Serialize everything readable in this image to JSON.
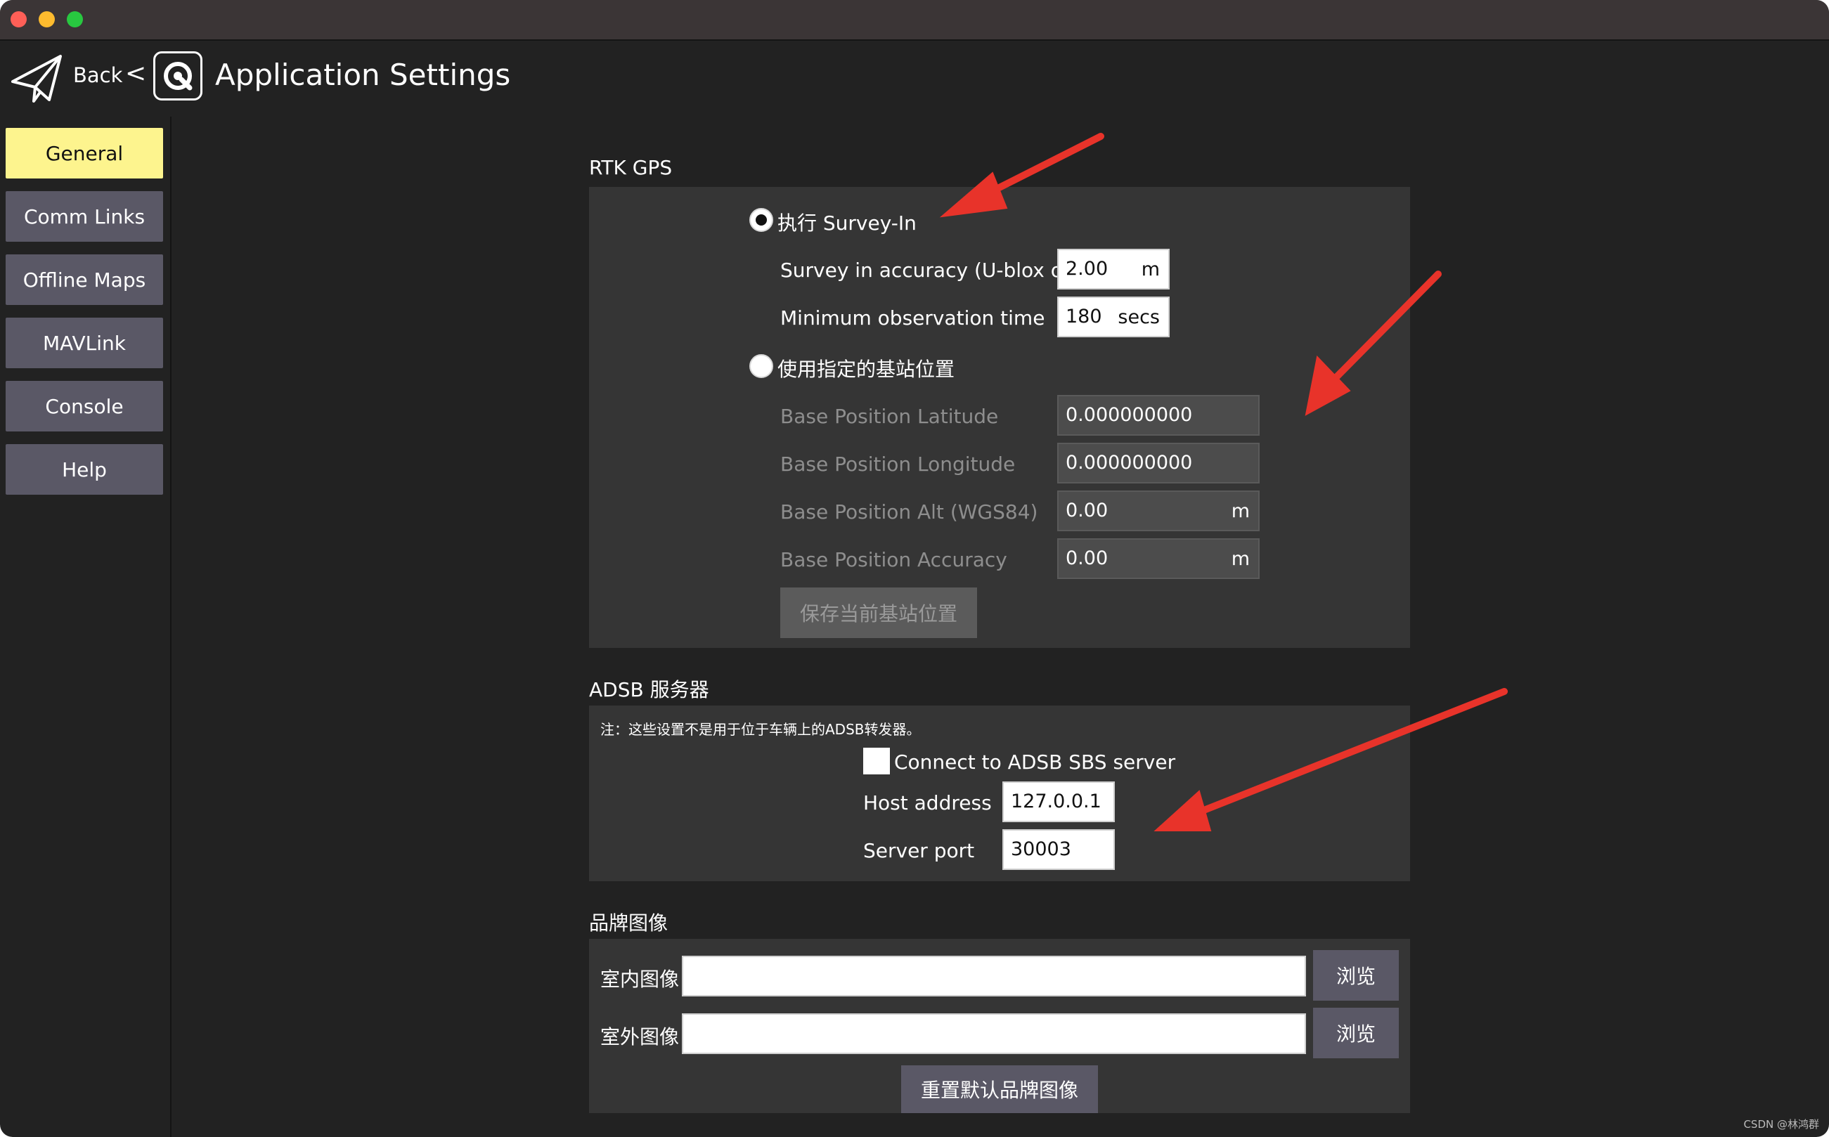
{
  "toolbar": {
    "back_label": "Back",
    "chevron": "<",
    "title": "Application Settings",
    "back_icon": "paper-plane-icon",
    "logo_icon": "app-logo-icon"
  },
  "sidebar": {
    "items": [
      {
        "label": "General",
        "active": true
      },
      {
        "label": "Comm Links",
        "active": false
      },
      {
        "label": "Offline Maps",
        "active": false
      },
      {
        "label": "MAVLink",
        "active": false
      },
      {
        "label": "Console",
        "active": false
      },
      {
        "label": "Help",
        "active": false
      }
    ]
  },
  "rtk": {
    "title": "RTK GPS",
    "survey_in_option": "执行 Survey-In",
    "survey_in_selected": true,
    "accuracy_label": "Survey in accuracy (U-blox only)",
    "accuracy_value": "2.00",
    "accuracy_unit": "m",
    "obs_time_label": "Minimum observation time",
    "obs_time_value": "180",
    "obs_time_unit": "secs",
    "fixed_base_option": "使用指定的基站位置",
    "fixed_base_selected": false,
    "lat_label": "Base Position Latitude",
    "lat_value": "0.000000000",
    "lon_label": "Base Position Longitude",
    "lon_value": "0.000000000",
    "alt_label": "Base Position Alt (WGS84)",
    "alt_value": "0.00",
    "alt_unit": "m",
    "acc_label": "Base Position Accuracy",
    "acc_value": "0.00",
    "acc_unit": "m",
    "save_button": "保存当前基站位置"
  },
  "adsb": {
    "title": "ADSB 服务器",
    "note": "注：这些设置不是用于位于车辆上的ADSB转发器。",
    "connect_label": "Connect to ADSB SBS server",
    "connect_checked": false,
    "host_label": "Host address",
    "host_value": "127.0.0.1",
    "port_label": "Server port",
    "port_value": "30003"
  },
  "brand": {
    "title": "品牌图像",
    "indoor_label": "室内图像",
    "indoor_value": "",
    "outdoor_label": "室外图像",
    "outdoor_value": "",
    "browse_label": "浏览",
    "reset_button": "重置默认品牌图像"
  },
  "annotations": {
    "arrow_color": "#e8332a"
  },
  "colors": {
    "window_bg": "#222222",
    "panel_bg": "#353535",
    "button_bg": "#5a5866",
    "active_nav": "#fdf48e"
  },
  "watermark": "CSDN @林鸿群"
}
